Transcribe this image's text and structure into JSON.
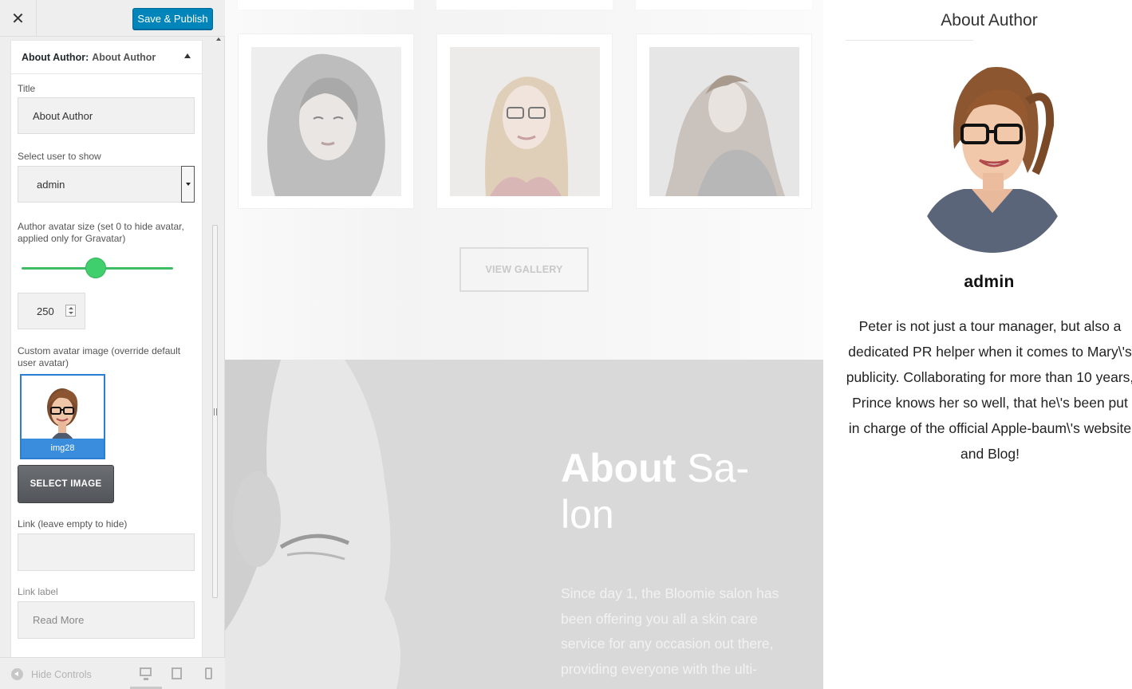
{
  "sidebar": {
    "close_glyph": "✕",
    "publish_label": "Save & Publish",
    "widget": {
      "type_label": "About Author:",
      "instance_title": "About Author",
      "fields": {
        "title_label": "Title",
        "title_value": "About Author",
        "user_label": "Select user to show",
        "user_value": "admin",
        "avatar_size_label": "Author avatar size (set 0 to hide avatar, applied only for Gravatar)",
        "avatar_size_value": "250",
        "custom_avatar_label": "Custom avatar image (override default user avatar)",
        "custom_avatar_caption": "img28",
        "select_image_label": "SELECT IMAGE",
        "link_label": "Link (leave empty to hide)",
        "link_value": "",
        "link_label_label": "Link label",
        "link_label_value": "Read More"
      }
    },
    "footer": {
      "hide_controls_label": "Hide Controls",
      "devices": [
        "desktop-icon",
        "tablet-icon",
        "mobile-icon"
      ],
      "active_device": "desktop"
    }
  },
  "preview": {
    "gallery": {
      "button_label": "VIEW GALLERY"
    },
    "about_salon": {
      "heading_bold": "About",
      "heading_light": "Sa-\nlon",
      "text": "Since day 1, the Bloomie salon has been offering you all a skin care service for any occasion out there, providing everyone with the ulti-"
    },
    "author_widget": {
      "title": "About Author",
      "name": "admin",
      "bio": "Peter is not just a tour manager, but also a dedicated PR helper when it comes to Mary\\'s publicity. Collaborating for more than 10 years, Prince knows her so well, that he\\'s been put in charge of the official Apple-baum\\'s website and Blog!"
    }
  },
  "colors": {
    "publish_button": "#0085ba",
    "slider_accent": "#3fcf6c",
    "selected_thumb_border": "#2a7fd4"
  }
}
